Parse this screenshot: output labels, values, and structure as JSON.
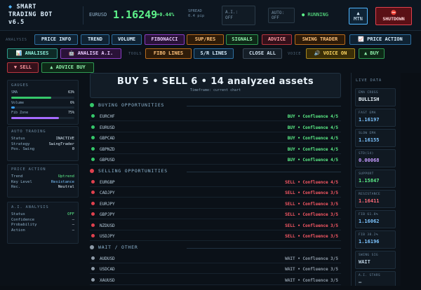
{
  "header": {
    "logo_line1": "◆ SMART",
    "logo_line2": "TRADING BOT",
    "logo_line3": "v6.5",
    "pair": "EURUSD",
    "price": "1.16249",
    "change": "+0.44%",
    "spread_label": "SPREAD",
    "spread_value": "0.4 pip",
    "ai_label": "A.I.:",
    "ai_value": "OFF",
    "auto_label": "AUTO:",
    "auto_value": "OFF",
    "running": "● RUNNING",
    "mtn_line1": "▲",
    "mtn_line2": "MTN",
    "shutdown_line1": "⛔",
    "shutdown_line2": "SHUTDOWN"
  },
  "toolbar": {
    "row1_label": "ANALYSIS",
    "row1": [
      "PRICE INFO",
      "TREND",
      "VOLUME",
      "FIBONACCI",
      "SUP/RES",
      "SIGNALS",
      "ADVICE",
      "SWING TRADER",
      "📈 PRICE ACTION"
    ],
    "row2_btns_a": [
      "📊 ANALISES",
      "🤖 ANALISE A.I."
    ],
    "row2_label_tools": "TOOLS",
    "row2_btns_b": [
      "FIBO LINES",
      "S/R LINES",
      "CLOSE ALL"
    ],
    "row2_label_voice": "VOICE",
    "row2_btns_c": [
      "🔊 VOICE ON",
      "▲ BUY"
    ],
    "row3": [
      "▼ SELL",
      "▲ ADVICE BUY"
    ]
  },
  "left": {
    "gauges_title": "GAUGES",
    "gauges": [
      {
        "label": "SMA",
        "value": "63%",
        "level": 63,
        "color": "#35c76a"
      },
      {
        "label": "Volume",
        "value": "6%",
        "level": 6,
        "color": "#3aa2ff"
      },
      {
        "label": "Fib Zone",
        "value": "75%",
        "level": 75,
        "color": "#a56bff"
      }
    ],
    "auto_title": "AUTO TRADING",
    "auto": [
      {
        "k": "Status",
        "v": "INACTIVE"
      },
      {
        "k": "Strategy",
        "v": "SwingTrader"
      },
      {
        "k": "Pos. Swing",
        "v": "0"
      }
    ],
    "pa_title": "PRICE ACTION",
    "pa": [
      {
        "k": "Trend",
        "v": "Uptrend"
      },
      {
        "k": "Key Level",
        "v": "Resistance"
      },
      {
        "k": "Rec.",
        "v": "Neutral"
      }
    ],
    "ai_title": "A.I. ANALYSIS",
    "ai": [
      {
        "k": "Status",
        "v": "OFF"
      },
      {
        "k": "Confidence",
        "v": "—"
      },
      {
        "k": "Probability",
        "v": "—"
      },
      {
        "k": "Action",
        "v": "—"
      }
    ]
  },
  "center": {
    "summary": "BUY 5 • SELL 6 • 14 analyzed assets",
    "timeframe": "Timeframe: current chart",
    "buy_title": "BUYING OPPORTUNITIES",
    "buy": [
      {
        "name": "EURCHF",
        "sig": "BUY • Confluence 4/5"
      },
      {
        "name": "EURUSD",
        "sig": "BUY • Confluence 4/5"
      },
      {
        "name": "GBPCAD",
        "sig": "BUY • Confluence 4/5"
      },
      {
        "name": "GBPNZD",
        "sig": "BUY • Confluence 4/5"
      },
      {
        "name": "GBPUSD",
        "sig": "BUY • Confluence 4/5"
      }
    ],
    "sell_title": "SELLING OPPORTUNITIES",
    "sell": [
      {
        "name": "EURGBP",
        "sig": "SELL • Confluence 4/5"
      },
      {
        "name": "CADJPY",
        "sig": "SELL • Confluence 3/5"
      },
      {
        "name": "EURJPY",
        "sig": "SELL • Confluence 3/5"
      },
      {
        "name": "GBPJPY",
        "sig": "SELL • Confluence 3/5"
      },
      {
        "name": "NZDUSD",
        "sig": "SELL • Confluence 3/5"
      },
      {
        "name": "USDJPY",
        "sig": "SELL • Confluence 3/5"
      }
    ],
    "wait_title": "WAIT / OTHER",
    "wait": [
      {
        "name": "AUDUSD",
        "sig": "WAIT • Confluence 3/5"
      },
      {
        "name": "USDCAD",
        "sig": "WAIT • Confluence 3/5"
      },
      {
        "name": "XAUUSD",
        "sig": "WAIT • Confluence 3/5"
      }
    ]
  },
  "right": {
    "title": "LIVE DATA",
    "metrics": [
      {
        "k": "EMA CROSS",
        "v": "BULLISH",
        "color": "#e9f3fb"
      },
      {
        "k": "FAST EMA",
        "v": "1.16197",
        "color": "#7cc4ff"
      },
      {
        "k": "SLOW EMA",
        "v": "1.16155",
        "color": "#7cc4ff"
      },
      {
        "k": "STD(14)",
        "v": "0.00068",
        "color": "#c59bff"
      },
      {
        "k": "SUPPORT",
        "v": "1.15847",
        "color": "#5df28a"
      },
      {
        "k": "RESISTANCE",
        "v": "1.16411",
        "color": "#ff6b78"
      },
      {
        "k": "FIB 61.8%",
        "v": "1.16062",
        "color": "#7cc4ff"
      },
      {
        "k": "FIB 38.2%",
        "v": "1.16196",
        "color": "#7cc4ff"
      },
      {
        "k": "SWING SIG",
        "v": "WAIT",
        "color": "#b8cddd"
      },
      {
        "k": "A.I. STARS",
        "v": "—",
        "color": "#b8cddd"
      }
    ]
  },
  "colors": {
    "buy": "#35c76a",
    "sell": "#e0414e",
    "wait": "#8e9ba8",
    "buy_text": "#5df28a",
    "sell_text": "#ff5a67",
    "wait_text": "#8e9ba8"
  }
}
